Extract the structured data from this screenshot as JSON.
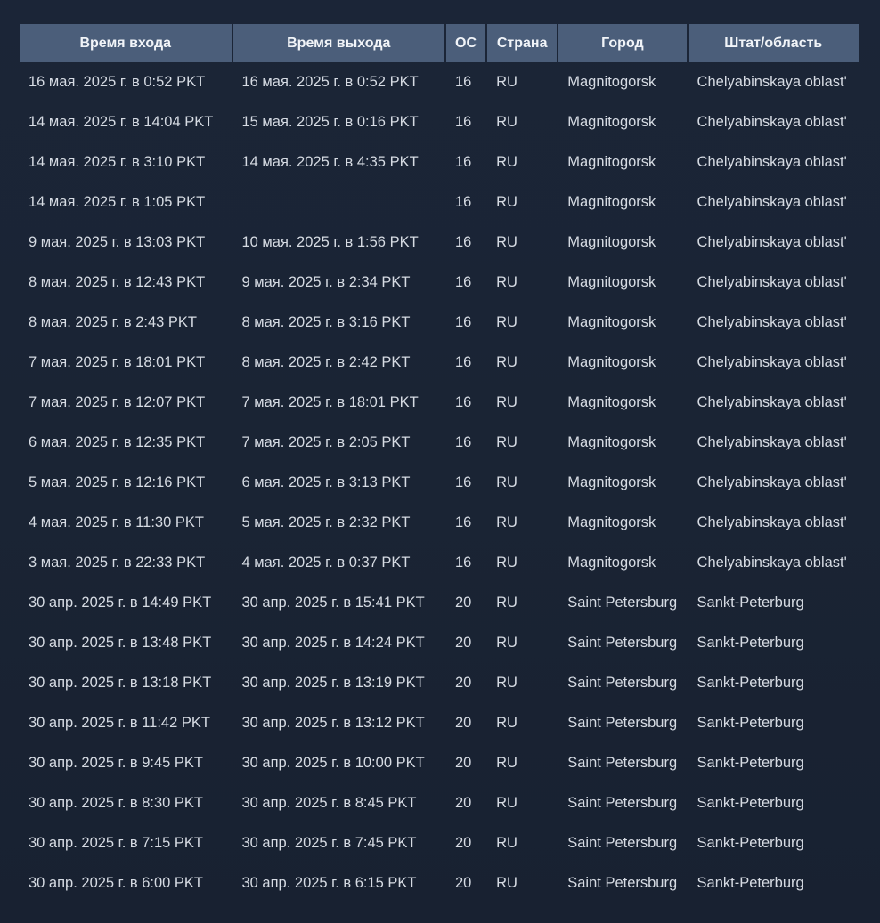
{
  "headers": [
    "Время входа",
    "Время выхода",
    "ОС",
    "Страна",
    "Город",
    "Штат/область"
  ],
  "rows": [
    [
      "16 мая. 2025 г. в 0:52 PKT",
      "16 мая. 2025 г. в 0:52 PKT",
      "16",
      "RU",
      "Magnitogorsk",
      "Chelyabinskaya oblast'"
    ],
    [
      "14 мая. 2025 г. в 14:04 PKT",
      "15 мая. 2025 г. в 0:16 PKT",
      "16",
      "RU",
      "Magnitogorsk",
      "Chelyabinskaya oblast'"
    ],
    [
      "14 мая. 2025 г. в 3:10 PKT",
      "14 мая. 2025 г. в 4:35 PKT",
      "16",
      "RU",
      "Magnitogorsk",
      "Chelyabinskaya oblast'"
    ],
    [
      "14 мая. 2025 г. в 1:05 PKT",
      "",
      "16",
      "RU",
      "Magnitogorsk",
      "Chelyabinskaya oblast'"
    ],
    [
      "9 мая. 2025 г. в 13:03 PKT",
      "10 мая. 2025 г. в 1:56 PKT",
      "16",
      "RU",
      "Magnitogorsk",
      "Chelyabinskaya oblast'"
    ],
    [
      "8 мая. 2025 г. в 12:43 PKT",
      "9 мая. 2025 г. в 2:34 PKT",
      "16",
      "RU",
      "Magnitogorsk",
      "Chelyabinskaya oblast'"
    ],
    [
      "8 мая. 2025 г. в 2:43 PKT",
      "8 мая. 2025 г. в 3:16 PKT",
      "16",
      "RU",
      "Magnitogorsk",
      "Chelyabinskaya oblast'"
    ],
    [
      "7 мая. 2025 г. в 18:01 PKT",
      "8 мая. 2025 г. в 2:42 PKT",
      "16",
      "RU",
      "Magnitogorsk",
      "Chelyabinskaya oblast'"
    ],
    [
      "7 мая. 2025 г. в 12:07 PKT",
      "7 мая. 2025 г. в 18:01 PKT",
      "16",
      "RU",
      "Magnitogorsk",
      "Chelyabinskaya oblast'"
    ],
    [
      "6 мая. 2025 г. в 12:35 PKT",
      "7 мая. 2025 г. в 2:05 PKT",
      "16",
      "RU",
      "Magnitogorsk",
      "Chelyabinskaya oblast'"
    ],
    [
      "5 мая. 2025 г. в 12:16 PKT",
      "6 мая. 2025 г. в 3:13 PKT",
      "16",
      "RU",
      "Magnitogorsk",
      "Chelyabinskaya oblast'"
    ],
    [
      "4 мая. 2025 г. в 11:30 PKT",
      "5 мая. 2025 г. в 2:32 PKT",
      "16",
      "RU",
      "Magnitogorsk",
      "Chelyabinskaya oblast'"
    ],
    [
      "3 мая. 2025 г. в 22:33 PKT",
      "4 мая. 2025 г. в 0:37 PKT",
      "16",
      "RU",
      "Magnitogorsk",
      "Chelyabinskaya oblast'"
    ],
    [
      "30 апр. 2025 г. в 14:49 PKT",
      "30 апр. 2025 г. в 15:41 PKT",
      "20",
      "RU",
      "Saint Petersburg",
      "Sankt-Peterburg"
    ],
    [
      "30 апр. 2025 г. в 13:48 PKT",
      "30 апр. 2025 г. в 14:24 PKT",
      "20",
      "RU",
      "Saint Petersburg",
      "Sankt-Peterburg"
    ],
    [
      "30 апр. 2025 г. в 13:18 PKT",
      "30 апр. 2025 г. в 13:19 PKT",
      "20",
      "RU",
      "Saint Petersburg",
      "Sankt-Peterburg"
    ],
    [
      "30 апр. 2025 г. в 11:42 PKT",
      "30 апр. 2025 г. в 13:12 PKT",
      "20",
      "RU",
      "Saint Petersburg",
      "Sankt-Peterburg"
    ],
    [
      "30 апр. 2025 г. в 9:45 PKT",
      "30 апр. 2025 г. в 10:00 PKT",
      "20",
      "RU",
      "Saint Petersburg",
      "Sankt-Peterburg"
    ],
    [
      "30 апр. 2025 г. в 8:30 PKT",
      "30 апр. 2025 г. в 8:45 PKT",
      "20",
      "RU",
      "Saint Petersburg",
      "Sankt-Peterburg"
    ],
    [
      "30 апр. 2025 г. в 7:15 PKT",
      "30 апр. 2025 г. в 7:45 PKT",
      "20",
      "RU",
      "Saint Petersburg",
      "Sankt-Peterburg"
    ],
    [
      "30 апр. 2025 г. в 6:00 PKT",
      "30 апр. 2025 г. в 6:15 PKT",
      "20",
      "RU",
      "Saint Petersburg",
      "Sankt-Peterburg"
    ]
  ]
}
